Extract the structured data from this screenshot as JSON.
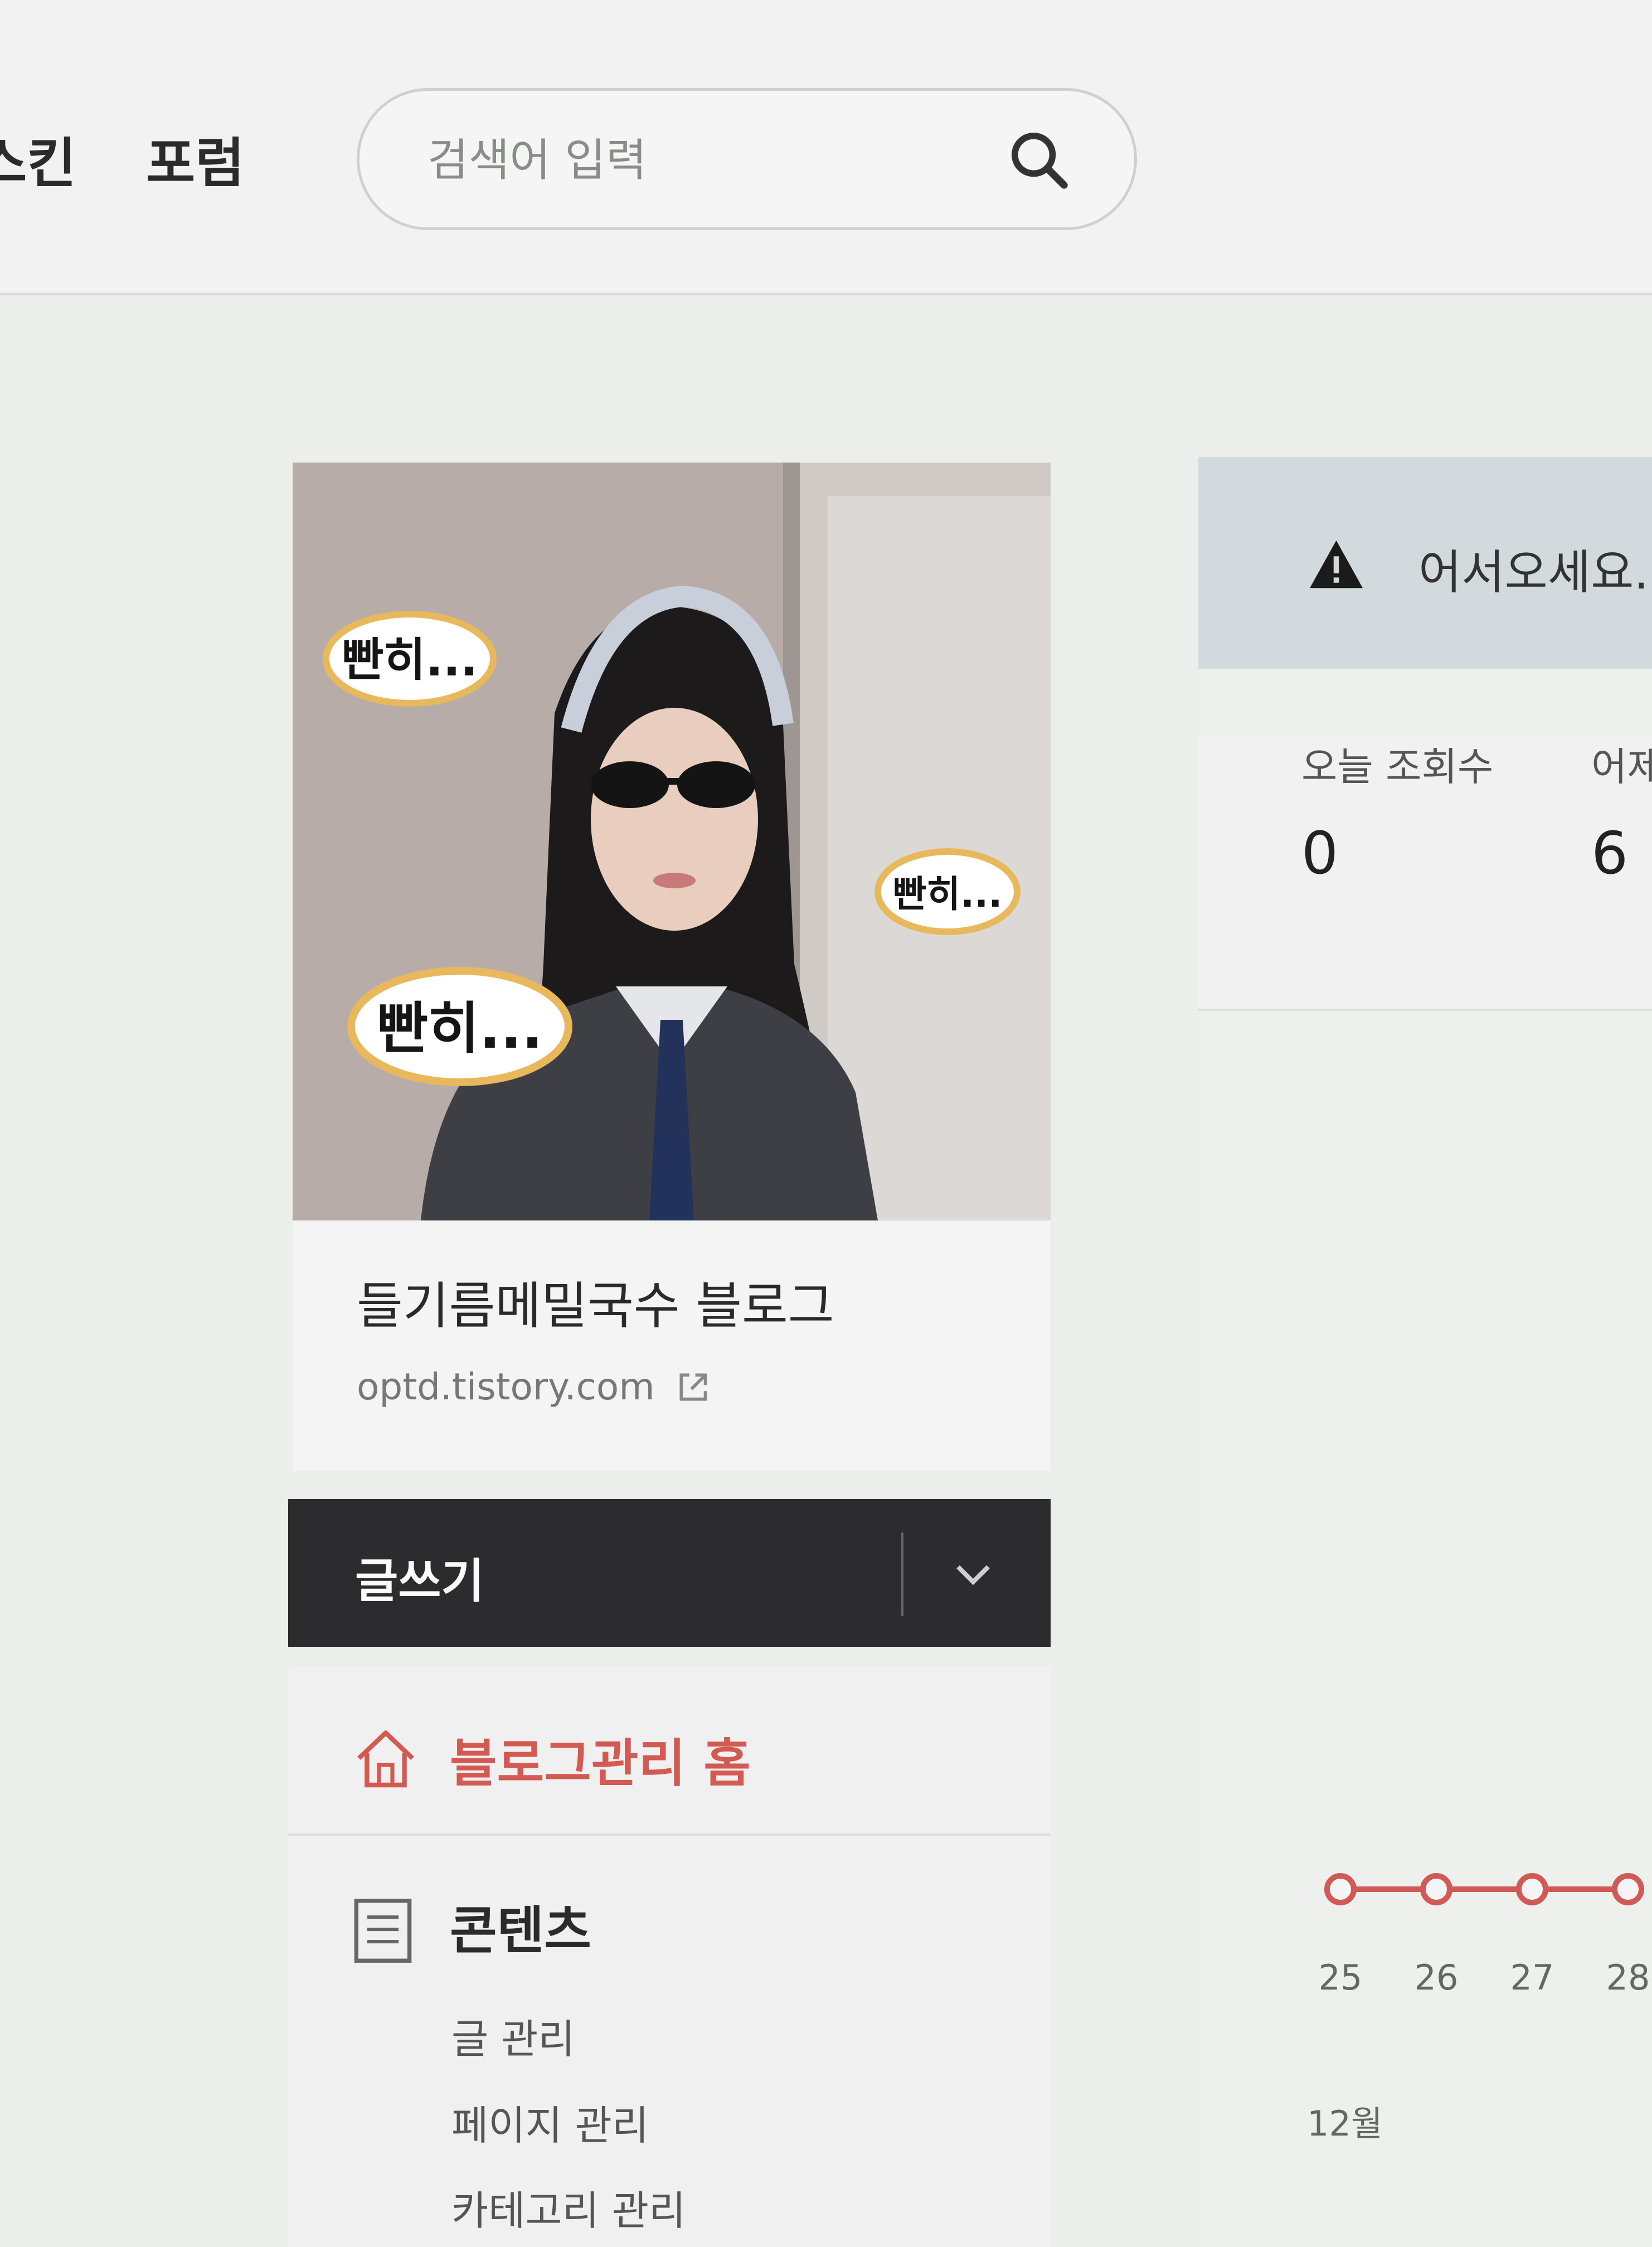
{
  "header": {
    "nav": [
      "스킨",
      "포럼"
    ],
    "search": {
      "placeholder": "검색어 입력",
      "value": ""
    }
  },
  "blog": {
    "title": "들기름메밀국수 블로그",
    "url": "optd.tistory.com",
    "stickers": [
      "빤히...",
      "빤히...",
      "빤히..."
    ]
  },
  "write": {
    "label": "글쓰기"
  },
  "menu": {
    "home_label": "블로그관리 홈",
    "contents_label": "콘텐츠",
    "contents_items": [
      "글 관리",
      "페이지 관리",
      "카테고리 관리"
    ]
  },
  "notice": {
    "text": "어서오세요."
  },
  "stats": {
    "today_label": "오늘 조회수",
    "today_value": "0",
    "yesterday_label": "어제",
    "yesterday_value": "6"
  },
  "chart_data": {
    "type": "line",
    "x": [
      "25",
      "26",
      "27",
      "28"
    ],
    "series": [
      {
        "values": [
          0,
          0,
          0,
          0
        ]
      }
    ],
    "month_label": "12월",
    "color": "#d05a56"
  },
  "colors": {
    "accent": "#d35a52",
    "write_bar": "#2c2c2e",
    "notice_bg": "#d2dadd"
  }
}
